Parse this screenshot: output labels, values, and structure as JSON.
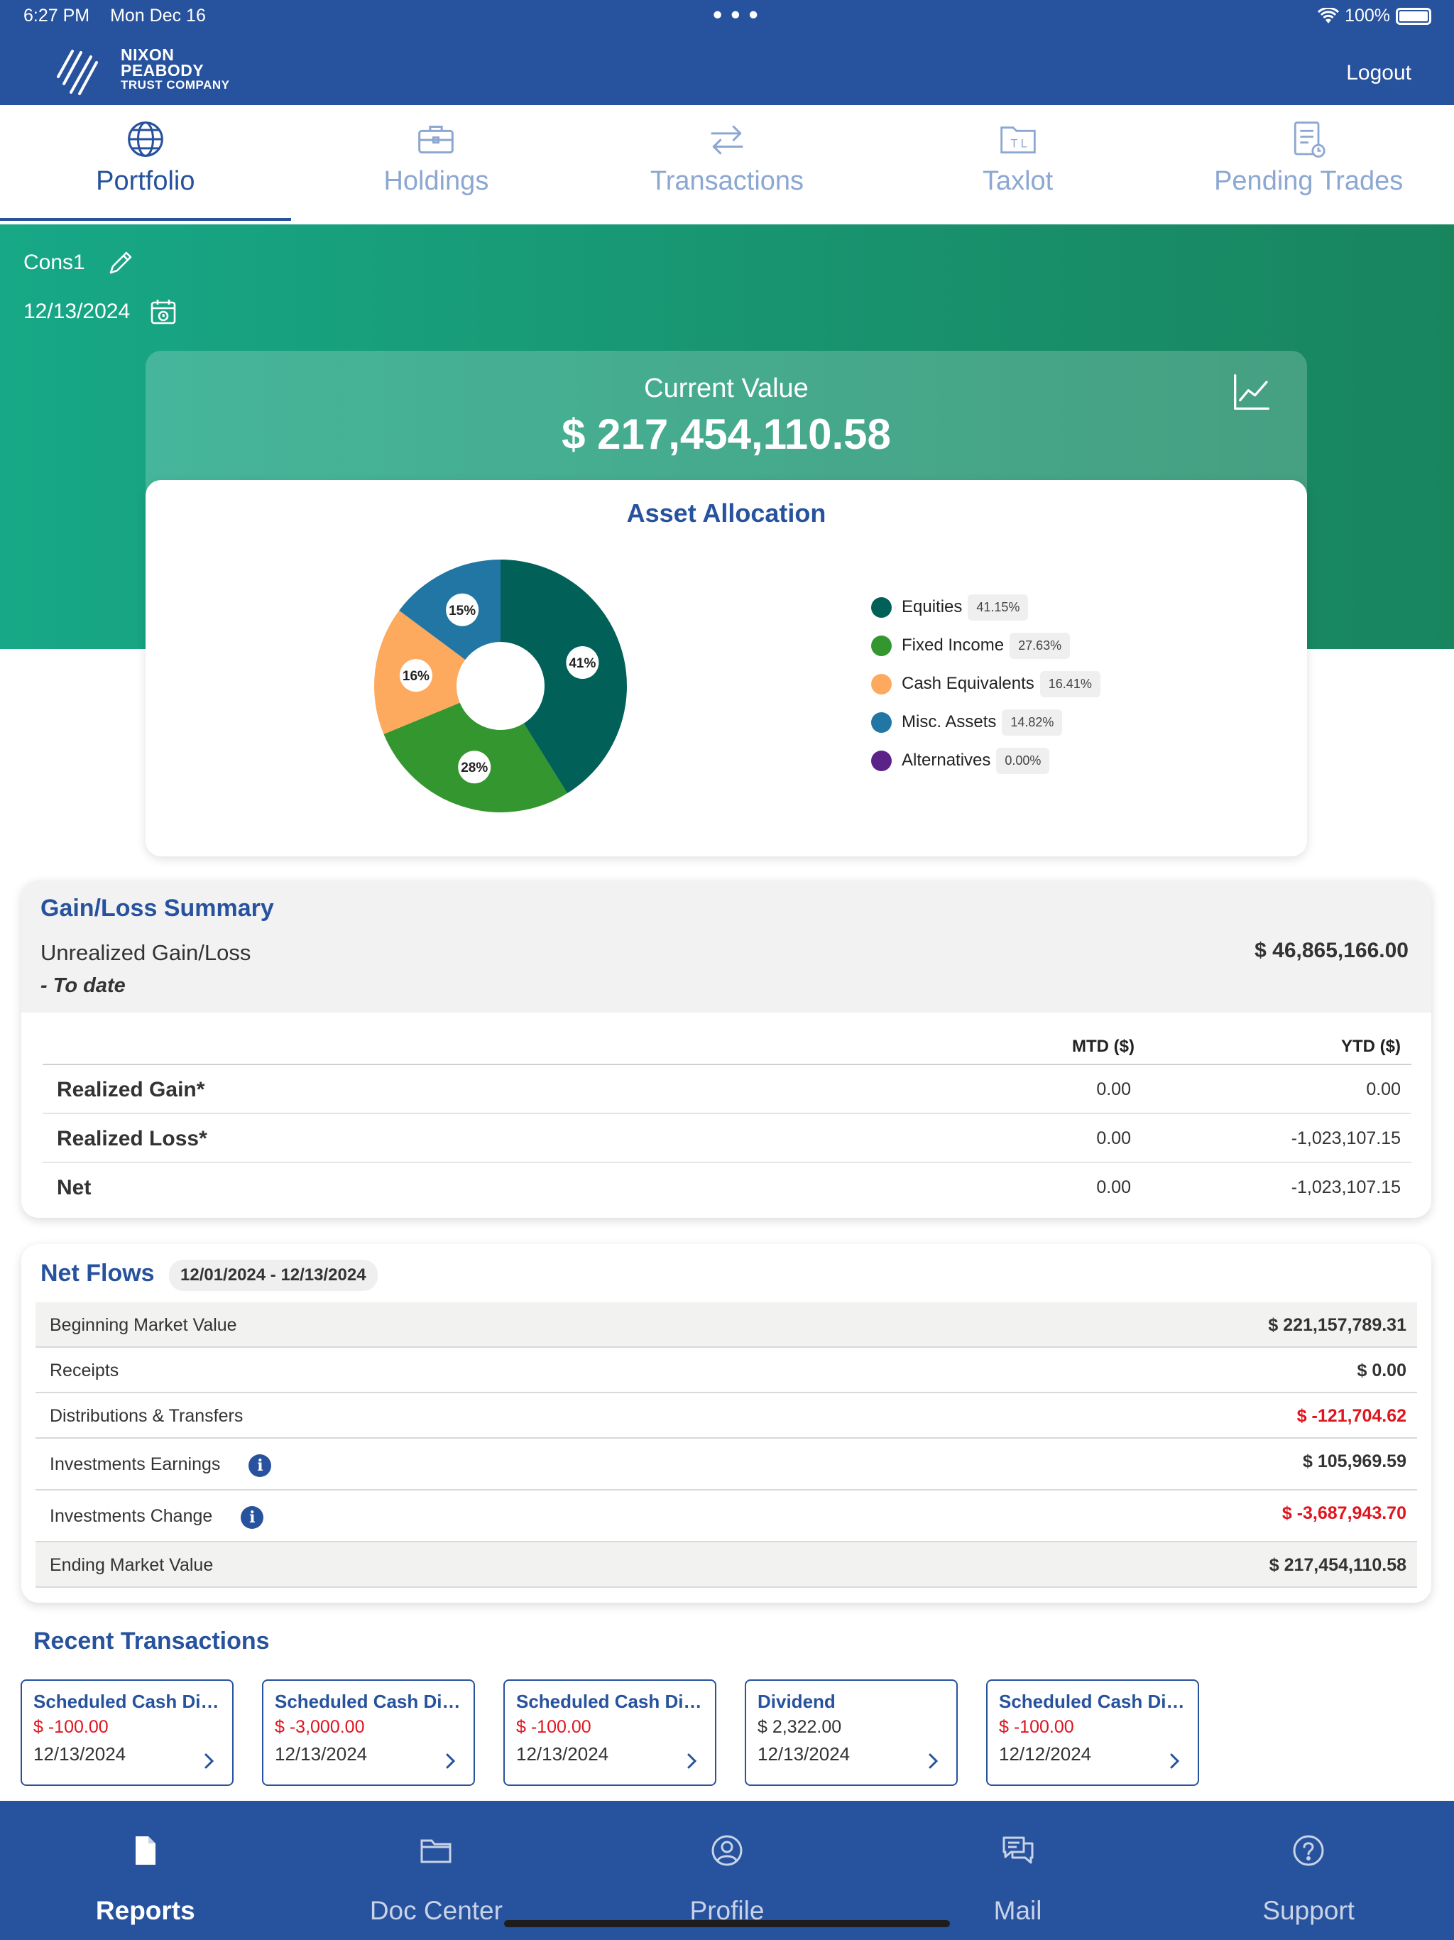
{
  "status_bar": {
    "time": "6:27 PM",
    "date": "Mon Dec 16",
    "battery": "100%"
  },
  "header": {
    "logo_line1": "NIXON",
    "logo_line2": "PEABODY",
    "logo_line3": "TRUST COMPANY",
    "logout": "Logout"
  },
  "tabs": [
    {
      "label": "Portfolio",
      "icon": "globe-icon",
      "active": true
    },
    {
      "label": "Holdings",
      "icon": "briefcase-icon"
    },
    {
      "label": "Transactions",
      "icon": "transfer-arrows-icon"
    },
    {
      "label": "Taxlot",
      "icon": "taxlot-folder-icon"
    },
    {
      "label": "Pending Trades",
      "icon": "document-clock-icon"
    }
  ],
  "account": {
    "name": "Cons1",
    "date": "12/13/2024"
  },
  "current_value": {
    "title": "Current Value",
    "value": "$ 217,454,110.58"
  },
  "allocation": {
    "title": "Asset Allocation",
    "slice_labels": [
      "41%",
      "28%",
      "16%",
      "15%"
    ],
    "items": [
      {
        "name": "Equities",
        "pct": "41.15%",
        "color": "#016159"
      },
      {
        "name": "Fixed Income",
        "pct": "27.63%",
        "color": "#34962f"
      },
      {
        "name": "Cash Equivalents",
        "pct": "16.41%",
        "color": "#fda95e"
      },
      {
        "name": "Misc. Assets",
        "pct": "14.82%",
        "color": "#2176a4"
      },
      {
        "name": "Alternatives",
        "pct": "0.00%",
        "color": "#5b2388"
      }
    ]
  },
  "gain_loss": {
    "title": "Gain/Loss Summary",
    "unrealized_label": "Unrealized Gain/Loss",
    "to_date": "- To date",
    "unrealized_value": "$ 46,865,166.00",
    "col_mtd": "MTD ($)",
    "col_ytd": "YTD ($)",
    "rows": [
      {
        "name": "Realized Gain*",
        "mtd": "0.00",
        "ytd": "0.00"
      },
      {
        "name": "Realized Loss*",
        "mtd": "0.00",
        "ytd": "-1,023,107.15"
      },
      {
        "name": "Net",
        "mtd": "0.00",
        "ytd": "-1,023,107.15"
      }
    ]
  },
  "net_flows": {
    "title": "Net Flows",
    "range": "12/01/2024 - 12/13/2024",
    "rows": [
      {
        "name": "Beginning Market Value",
        "value": "$ 221,157,789.31"
      },
      {
        "name": "Receipts",
        "value": "$ 0.00"
      },
      {
        "name": "Distributions & Transfers",
        "value": "$ -121,704.62"
      },
      {
        "name": "Investments Earnings",
        "value": "$ 105,969.59"
      },
      {
        "name": "Investments Change",
        "value": "$ -3,687,943.70"
      },
      {
        "name": "Ending Market Value",
        "value": "$ 217,454,110.58"
      }
    ]
  },
  "recent": {
    "title": "Recent Transactions",
    "cards": [
      {
        "type": "Scheduled Cash Dis...",
        "amount": "$ -100.00",
        "date": "12/13/2024"
      },
      {
        "type": "Scheduled Cash Dis...",
        "amount": "$ -3,000.00",
        "date": "12/13/2024"
      },
      {
        "type": "Scheduled Cash Dis...",
        "amount": "$ -100.00",
        "date": "12/13/2024"
      },
      {
        "type": "Dividend",
        "amount": "$ 2,322.00",
        "date": "12/13/2024"
      },
      {
        "type": "Scheduled Cash Dis...",
        "amount": "$ -100.00",
        "date": "12/12/2024"
      }
    ]
  },
  "bottom_nav": [
    {
      "label": "Reports",
      "icon": "document-icon",
      "active": true
    },
    {
      "label": "Doc Center",
      "icon": "folder-icon"
    },
    {
      "label": "Profile",
      "icon": "user-circle-icon"
    },
    {
      "label": "Mail",
      "icon": "chat-bubbles-icon"
    },
    {
      "label": "Support",
      "icon": "help-circle-icon"
    }
  ]
}
